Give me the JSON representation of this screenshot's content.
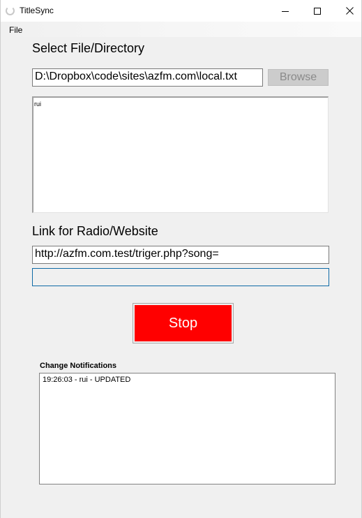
{
  "window": {
    "title": "TitleSync",
    "minimize_icon": "minimize-icon",
    "maximize_icon": "maximize-icon",
    "close_icon": "close-icon"
  },
  "menu": {
    "items": [
      {
        "label": "File"
      }
    ]
  },
  "file_section": {
    "heading": "Select File/Directory",
    "path_value": "D:\\Dropbox\\code\\sites\\azfm.com\\local.txt",
    "browse_label": "Browse",
    "preview_text": "rui"
  },
  "link_section": {
    "heading": "Link for Radio/Website",
    "url_value": "http://azfm.com.test/triger.php?song=",
    "extra_value": ""
  },
  "action": {
    "stop_label": "Stop",
    "stop_color": "#ff0000"
  },
  "notifications": {
    "heading": "Change Notifications",
    "items": [
      "19:26:03 - rui - UPDATED"
    ]
  }
}
